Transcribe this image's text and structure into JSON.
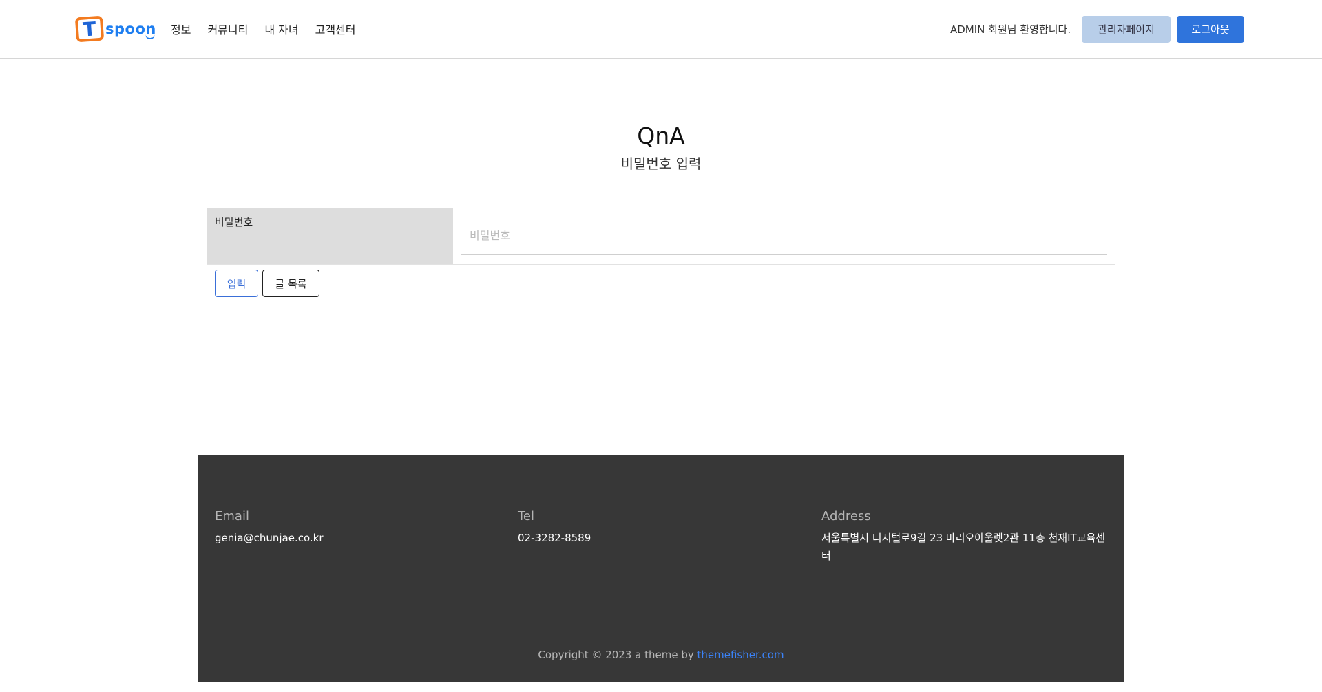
{
  "header": {
    "logo": {
      "mark": "T",
      "text": "spoon"
    },
    "nav": [
      "정보",
      "커뮤니티",
      "내 자녀",
      "고객센터"
    ],
    "welcome": "ADMIN 회원님 환영합니다.",
    "admin_button": "관리자페이지",
    "logout_button": "로그아웃"
  },
  "page": {
    "title": "QnA",
    "subtitle": "비밀번호 입력"
  },
  "form": {
    "password_label": "비밀번호",
    "password_placeholder": "비밀번호",
    "password_value": "",
    "submit_button": "입력",
    "list_button": "글 목록"
  },
  "footer": {
    "email_label": "Email",
    "email_value": "genia@chunjae.co.kr",
    "tel_label": "Tel",
    "tel_value": "02-3282-8589",
    "address_label": "Address",
    "address_value": "서울특별시 디지털로9길 23 마리오아울렛2관 11층 천재IT교육센터",
    "copyright_text": "Copyright © 2023 a theme by",
    "copyright_link": "themefisher.com"
  },
  "colors": {
    "primary": "#2f74dc",
    "logo_orange": "#f37b20",
    "footer_bg": "#373737",
    "admin_button_bg": "#b8cee9"
  }
}
